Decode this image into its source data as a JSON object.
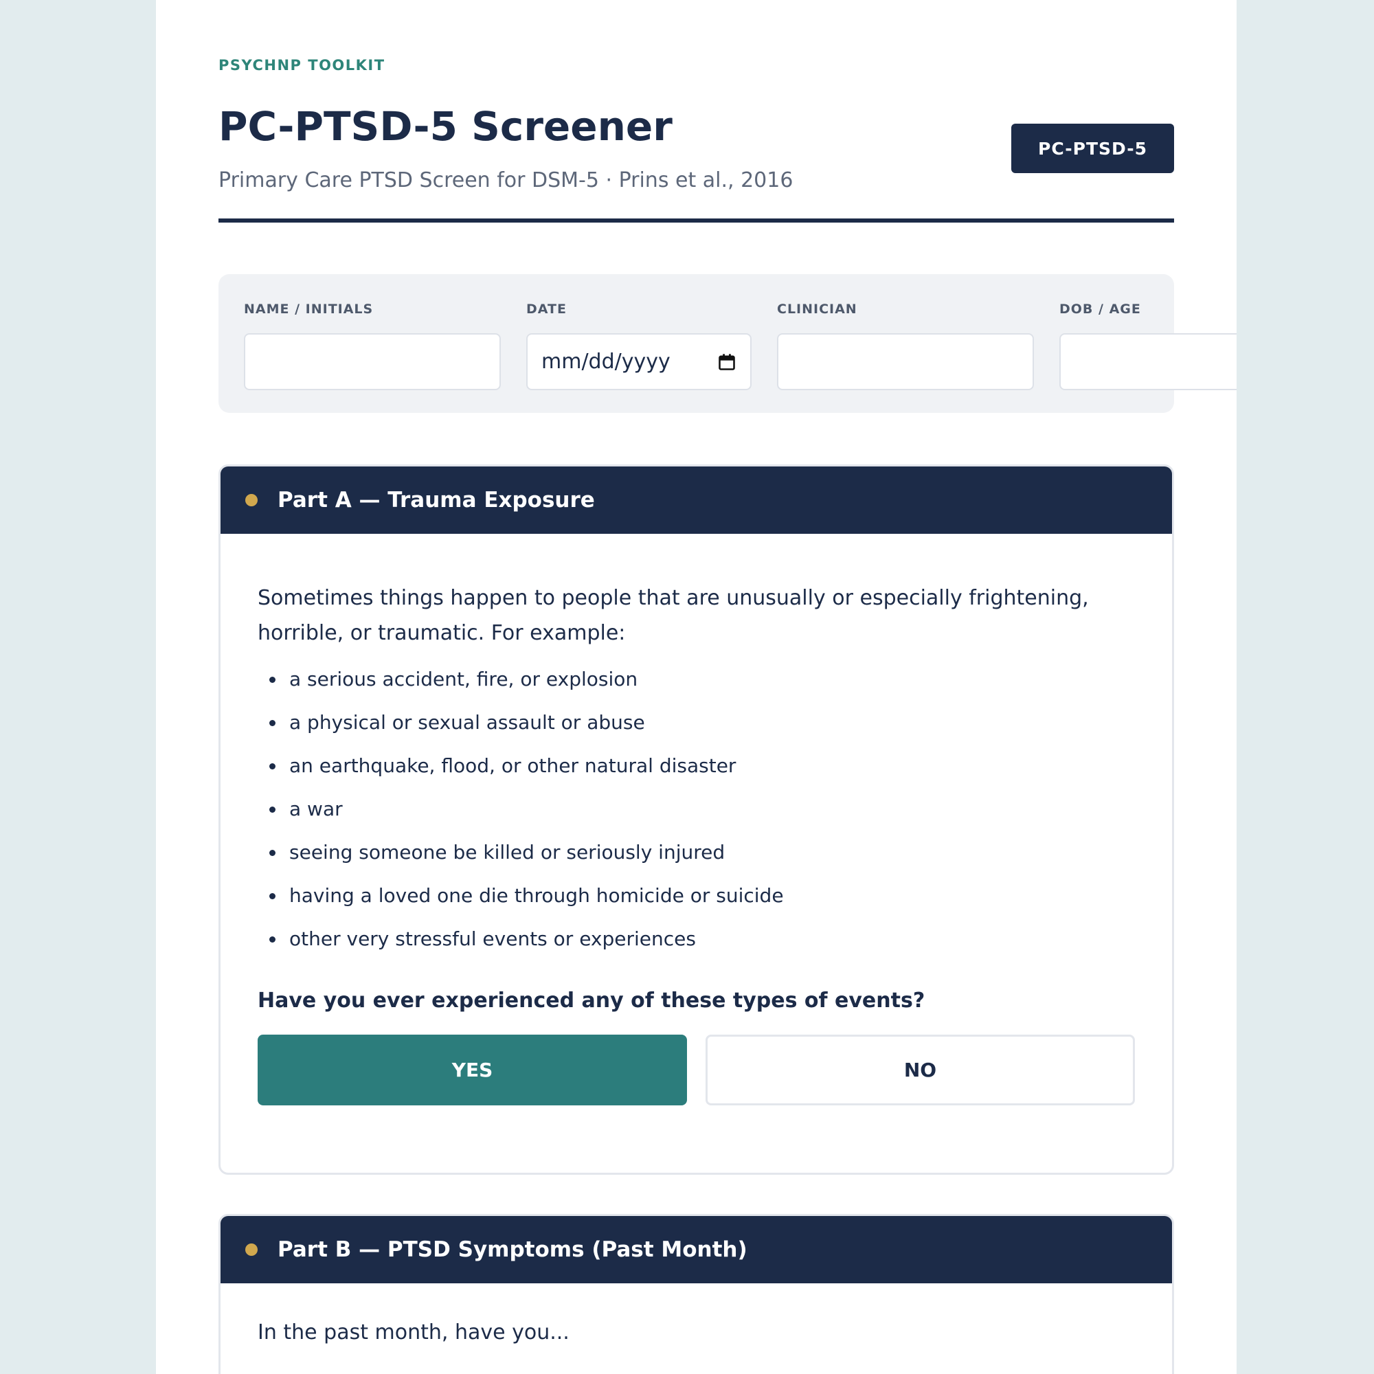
{
  "header": {
    "brand": "PSYCHNP TOOLKIT",
    "title": "PC-PTSD-5 Screener",
    "subtitle": "Primary Care PTSD Screen for DSM-5 · Prins et al., 2016",
    "badge": "PC-PTSD-5"
  },
  "patient_info": {
    "name_label": "NAME / INITIALS",
    "date_label": "DATE",
    "date_placeholder": "mm/dd/yyyy",
    "clinician_label": "CLINICIAN",
    "dob_label": "DOB / AGE"
  },
  "part_a": {
    "title": "Part A — Trauma Exposure",
    "intro": "Sometimes things happen to people that are unusually or especially frightening, horrible, or traumatic. For example:",
    "examples": [
      "a serious accident, fire, or explosion",
      "a physical or sexual assault or abuse",
      "an earthquake, flood, or other natural disaster",
      "a war",
      "seeing someone be killed or seriously injured",
      "having a loved one die through homicide or suicide",
      "other very stressful events or experiences"
    ],
    "question": "Have you ever experienced any of these types of events?",
    "yes_label": "YES",
    "no_label": "NO",
    "selected": "YES"
  },
  "part_b": {
    "title": "Part B — PTSD Symptoms (Past Month)",
    "intro": "In the past month, have you..."
  },
  "colors": {
    "navy": "#1c2b48",
    "teal": "#2c7d7c",
    "brand_teal": "#2e8579",
    "gold_dot": "#d1a84e",
    "page_bg": "#e2ecee"
  }
}
